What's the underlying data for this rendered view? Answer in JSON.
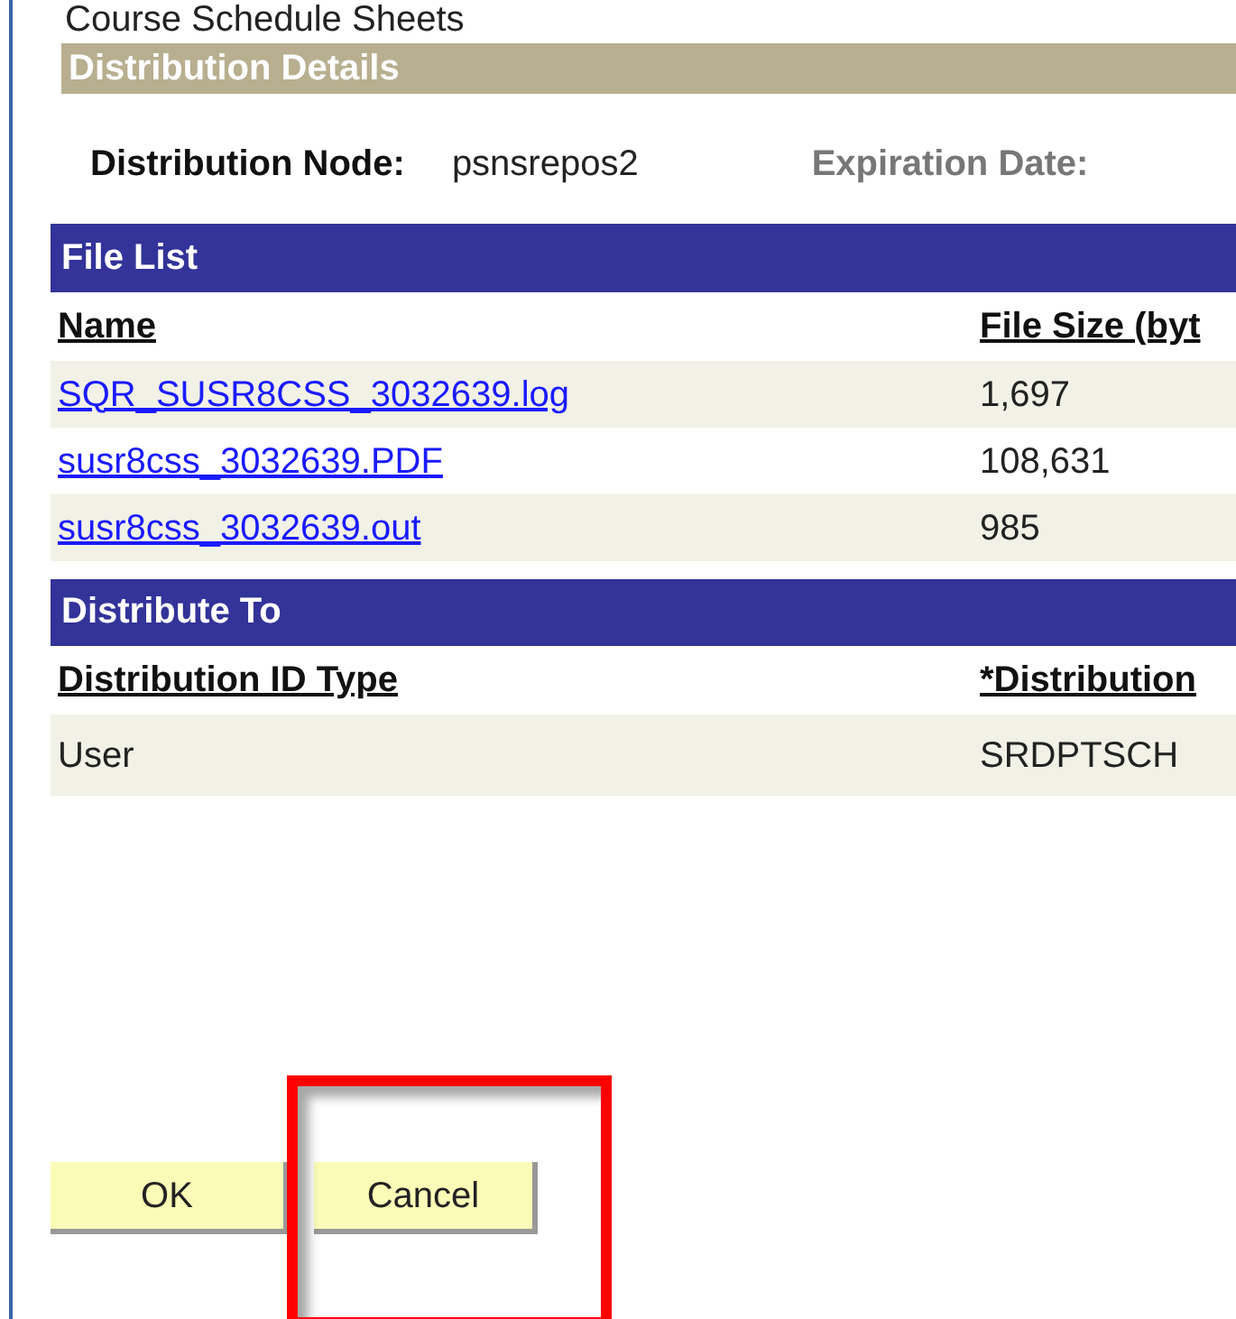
{
  "page_title": "Course Schedule Sheets",
  "distribution_details": {
    "title": "Distribution Details",
    "node_label": "Distribution Node:",
    "node_value": "psnsrepos2",
    "expiration_label": "Expiration Date:"
  },
  "file_list": {
    "title": "File List",
    "columns": [
      "Name",
      "File Size (byt"
    ],
    "rows": [
      {
        "name": "SQR_SUSR8CSS_3032639.log",
        "size": "1,697"
      },
      {
        "name": "susr8css_3032639.PDF",
        "size": "108,631"
      },
      {
        "name": "susr8css_3032639.out",
        "size": "985"
      }
    ]
  },
  "distribute_to": {
    "title": "Distribute To",
    "columns": [
      "Distribution ID Type",
      "*Distribution"
    ],
    "rows": [
      {
        "type": "User",
        "id": "SRDPTSCH"
      }
    ]
  },
  "buttons": [
    {
      "label": "OK",
      "highlighted": false
    },
    {
      "label": "Cancel",
      "highlighted": true
    }
  ]
}
